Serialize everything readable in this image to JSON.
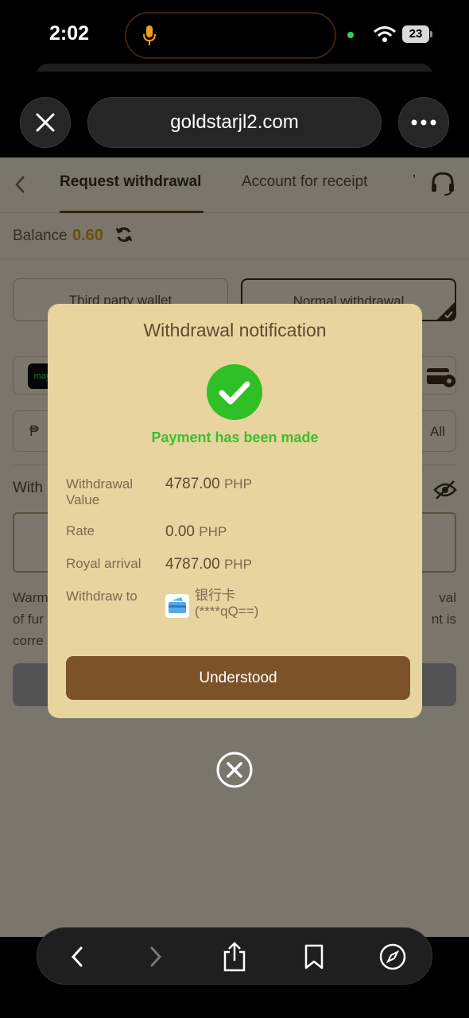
{
  "status_bar": {
    "time": "2:02",
    "battery": "23"
  },
  "browser": {
    "url": "goldstarjl2.com"
  },
  "page": {
    "tabs": [
      {
        "label": "Request withdrawal"
      },
      {
        "label": "Account for receipt"
      },
      {
        "label": "ʼ"
      }
    ],
    "balance": {
      "label": "Balance",
      "value": "0.60"
    },
    "methods": [
      {
        "label": "Third party wallet"
      },
      {
        "label": "Normal withdrawal"
      }
    ],
    "wallet_logo": "may",
    "amount": {
      "currency": "₱",
      "all_label": "All"
    },
    "password_label": "With",
    "warning": {
      "line1": "Warm",
      "line2": "of fur",
      "line3": "corre",
      "tail1": "val",
      "tail2": "nt is"
    }
  },
  "modal": {
    "title": "Withdrawal notification",
    "status": "Payment has been made",
    "rows": [
      {
        "label_line1": "Withdrawal",
        "label_line2": "Value",
        "amount": "4787.00",
        "unit": "PHP"
      },
      {
        "label": "Rate",
        "amount": "0.00",
        "unit": "PHP"
      },
      {
        "label": "Royal arrival",
        "amount": "4787.00",
        "unit": "PHP"
      }
    ],
    "withdraw_to": {
      "label": "Withdraw to",
      "bank_name": "银行卡",
      "account": "(****qQ==)"
    },
    "button": "Understood"
  },
  "colors": {
    "accent_gold": "#d99a1e",
    "success_green": "#3cbf2c",
    "button_brown": "#7c5228",
    "modal_bg": "#e8d49e"
  },
  "icons": [
    "microphone-icon",
    "wifi-icon",
    "battery-icon",
    "close-icon",
    "more-icon",
    "back-arrow-icon",
    "headset-icon",
    "refresh-icon",
    "card-settings-icon",
    "eye-off-icon",
    "check-circle-icon",
    "bank-card-icon",
    "close-circle-icon",
    "back-icon",
    "forward-icon",
    "share-icon",
    "bookmark-icon",
    "compass-icon"
  ]
}
